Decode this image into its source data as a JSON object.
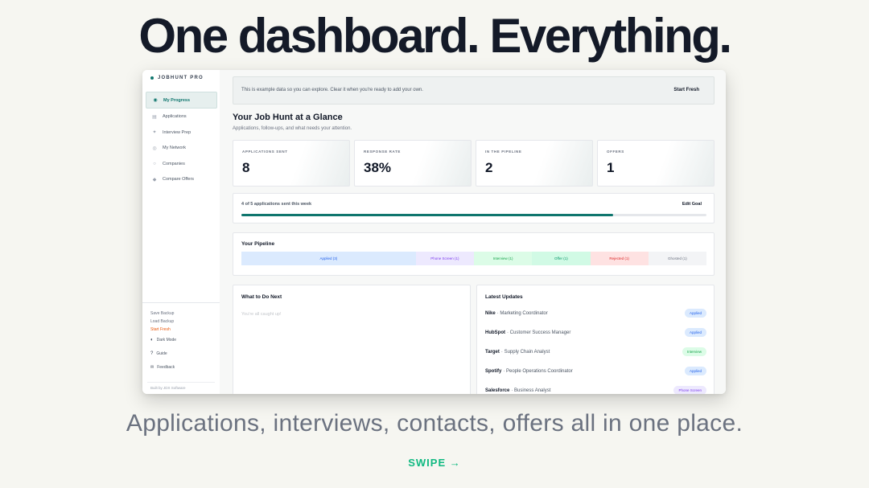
{
  "hero": {
    "headline": "One dashboard. Everything.",
    "subline": "Applications, interviews, contacts, offers all in one place.",
    "swipe": "SWIPE →"
  },
  "sidebar": {
    "brand": "JOBHUNT PRO",
    "items": [
      {
        "label": "My Progress",
        "icon": "target-icon",
        "glyph": "◉",
        "active": true
      },
      {
        "label": "Applications",
        "icon": "briefcase-icon",
        "glyph": "▤",
        "active": false
      },
      {
        "label": "Interview Prep",
        "icon": "sparkle-icon",
        "glyph": "✦",
        "active": false
      },
      {
        "label": "My Network",
        "icon": "people-icon",
        "glyph": "◎",
        "active": false
      },
      {
        "label": "Companies",
        "icon": "building-icon",
        "glyph": "○",
        "active": false
      },
      {
        "label": "Compare Offers",
        "icon": "diamond-icon",
        "glyph": "◆",
        "active": false
      }
    ],
    "save_backup": "Save Backup",
    "load_backup": "Load Backup",
    "start_fresh": "Start Fresh",
    "dark_mode": "Dark Mode",
    "guide": "Guide",
    "feedback": "Feedback",
    "built_by": "Built by JDX Software"
  },
  "banner": {
    "text": "This is example data so you can explore. Clear it when you're ready to add your own.",
    "button": "Start Fresh"
  },
  "page": {
    "title": "Your Job Hunt at a Glance",
    "subtitle": "Applications, follow-ups, and what needs your attention."
  },
  "stats": [
    {
      "label": "APPLICATIONS SENT",
      "value": "8"
    },
    {
      "label": "RESPONSE RATE",
      "value": "38%"
    },
    {
      "label": "IN THE PIPELINE",
      "value": "2"
    },
    {
      "label": "OFFERS",
      "value": "1"
    }
  ],
  "goal": {
    "text": "4 of 5 applications sent this week",
    "button": "Edit Goal",
    "progress": 0.8
  },
  "pipeline": {
    "title": "Your Pipeline",
    "segments": [
      {
        "label": "Applied (3)",
        "count": 3,
        "bg": "#dbeafe",
        "fg": "#2563eb"
      },
      {
        "label": "Phone Screen (1)",
        "count": 1,
        "bg": "#ede9fe",
        "fg": "#7c3aed"
      },
      {
        "label": "Interview (1)",
        "count": 1,
        "bg": "#dcfce7",
        "fg": "#16a34a"
      },
      {
        "label": "Offer (1)",
        "count": 1,
        "bg": "#d1fae5",
        "fg": "#059669"
      },
      {
        "label": "Rejected (1)",
        "count": 1,
        "bg": "#fee2e2",
        "fg": "#dc2626"
      },
      {
        "label": "Ghosted (1)",
        "count": 1,
        "bg": "#f3f4f6",
        "fg": "#6b7280"
      }
    ]
  },
  "todo": {
    "title": "What to Do Next",
    "empty": "You're all caught up!"
  },
  "updates": {
    "title": "Latest Updates",
    "items": [
      {
        "company": "Nike",
        "role": "· Marketing Coordinator",
        "status": "Applied",
        "bg": "#dbeafe",
        "fg": "#2563eb"
      },
      {
        "company": "HubSpot",
        "role": "· Customer Success Manager",
        "status": "Applied",
        "bg": "#dbeafe",
        "fg": "#2563eb"
      },
      {
        "company": "Target",
        "role": "· Supply Chain Analyst",
        "status": "Interview",
        "bg": "#dcfce7",
        "fg": "#16a34a"
      },
      {
        "company": "Spotify",
        "role": "· People Operations Coordinator",
        "status": "Applied",
        "bg": "#dbeafe",
        "fg": "#2563eb"
      },
      {
        "company": "Salesforce",
        "role": "· Business Analyst",
        "status": "Phone Screen",
        "bg": "#ede9fe",
        "fg": "#7c3aed"
      }
    ]
  },
  "colors": {
    "accent": "#0f766e",
    "cta": "#10b981",
    "warning": "#ea580c"
  }
}
